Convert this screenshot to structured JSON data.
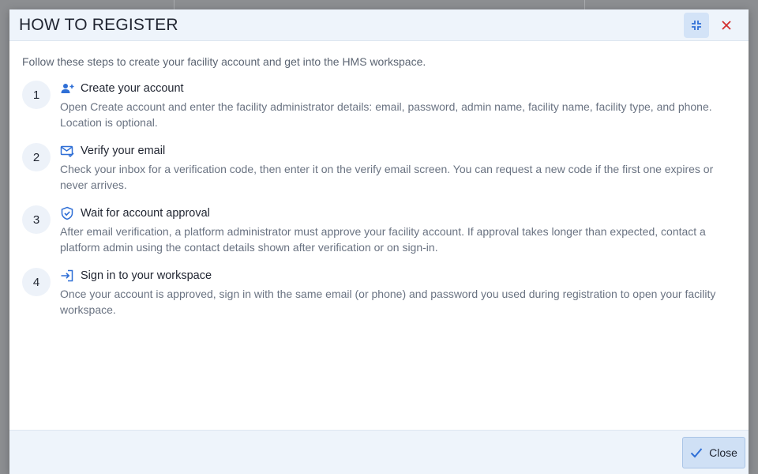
{
  "dialog": {
    "title": "HOW TO REGISTER",
    "intro": "Follow these steps to create your facility account and get into the HMS workspace.",
    "close_label": "Close"
  },
  "colors": {
    "accent": "#2f6fd6",
    "danger": "#d32f2f"
  },
  "steps": [
    {
      "number": "1",
      "icon": "user-plus-icon",
      "title": "Create your account",
      "description": "Open Create account and enter the facility administrator details: email, password, admin name, facility name, facility type, and phone. Location is optional."
    },
    {
      "number": "2",
      "icon": "mail-check-icon",
      "title": "Verify your email",
      "description": "Check your inbox for a verification code, then enter it on the verify email screen. You can request a new code if the first one expires or never arrives."
    },
    {
      "number": "3",
      "icon": "shield-check-icon",
      "title": "Wait for account approval",
      "description": "After email verification, a platform administrator must approve your facility account. If approval takes longer than expected, contact a platform admin using the contact details shown after verification or on sign-in."
    },
    {
      "number": "4",
      "icon": "sign-in-icon",
      "title": "Sign in to your workspace",
      "description": "Once your account is approved, sign in with the same email (or phone) and password you used during registration to open your facility workspace."
    }
  ]
}
